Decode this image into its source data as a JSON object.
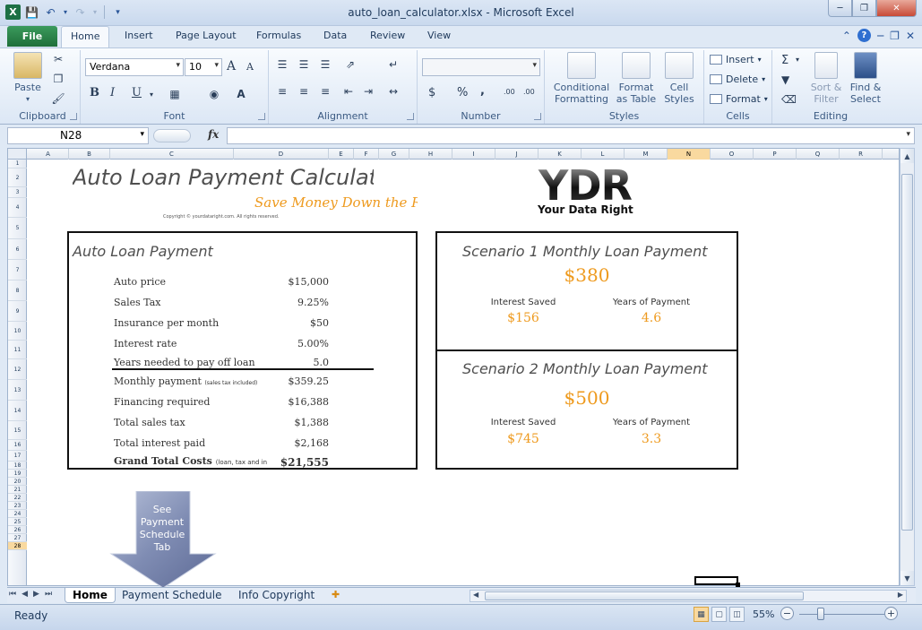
{
  "window": {
    "title": "auto_loan_calculator.xlsx - Microsoft Excel",
    "app_icon_letter": "X"
  },
  "ribbon_tabs": [
    "File",
    "Home",
    "Insert",
    "Page Layout",
    "Formulas",
    "Data",
    "Review",
    "View"
  ],
  "active_tab": "Home",
  "clipboard": {
    "paste": "Paste",
    "label": "Clipboard"
  },
  "font": {
    "name": "Verdana",
    "size": "10",
    "label": "Font",
    "bold": "B",
    "italic": "I",
    "underline": "U",
    "grow": "A",
    "shrink": "A"
  },
  "alignment": {
    "label": "Alignment"
  },
  "number": {
    "format": "",
    "label": "Number",
    "currency": "$",
    "percent": "%",
    "comma": ",",
    "inc_decimal": ".00",
    "dec_decimal": ".00"
  },
  "styles": {
    "label": "Styles",
    "conditional_line1": "Conditional",
    "conditional_line2": "Formatting",
    "format_table_line1": "Format",
    "format_table_line2": "as Table",
    "cell_styles_line1": "Cell",
    "cell_styles_line2": "Styles"
  },
  "cells": {
    "label": "Cells",
    "insert": "Insert",
    "delete": "Delete",
    "format": "Format"
  },
  "editing": {
    "label": "Editing",
    "sum": "Σ",
    "sort_line1": "Sort &",
    "sort_line2": "Filter",
    "find_line1": "Find &",
    "find_line2": "Select"
  },
  "formula_bar": {
    "name_box": "N28",
    "fx": "fx",
    "formula": ""
  },
  "columns": [
    "A",
    "B",
    "C",
    "D",
    "E",
    "F",
    "G",
    "H",
    "I",
    "J",
    "K",
    "L",
    "M",
    "N",
    "O",
    "P",
    "Q",
    "R"
  ],
  "selected_column": "N",
  "rows": [
    "1",
    "2",
    "3",
    "4",
    "5",
    "6",
    "7",
    "8",
    "9",
    "10",
    "11",
    "12",
    "13",
    "14",
    "15",
    "16",
    "17",
    "18",
    "19",
    "20",
    "21",
    "22",
    "23",
    "24",
    "25",
    "26",
    "27",
    "28"
  ],
  "selected_row": "28",
  "sheet": {
    "title": "Auto Loan Payment Calculator",
    "subtitle": "Save Money Down the Road",
    "copyright": "Copyright © yourdataright.com. All rights reserved.",
    "logo_letters": "YDR",
    "logo_tagline": "Your Data Right"
  },
  "loan_box": {
    "title": "Auto Loan Payment",
    "rows": [
      {
        "label": "Auto price",
        "value": "$15,000"
      },
      {
        "label": "Sales Tax",
        "value": "9.25%"
      },
      {
        "label": "Insurance per month",
        "value": "$50"
      },
      {
        "label": "Interest rate",
        "value": "5.00%"
      },
      {
        "label": "Years needed to pay off loan",
        "value": "5.0"
      },
      {
        "label": "Monthly payment",
        "note": "(sales tax included)",
        "value": "$359.25"
      },
      {
        "label": "Financing required",
        "value": "$16,388"
      },
      {
        "label": "Total sales tax",
        "value": "$1,388"
      },
      {
        "label": "Total interest paid",
        "value": "$2,168"
      },
      {
        "label": "Grand Total Costs",
        "note": "(loan, tax and in",
        "value": "$21,555"
      }
    ]
  },
  "scenario1": {
    "title": "Scenario 1 Monthly Loan Payment",
    "amount": "$380",
    "interest_label": "Interest Saved",
    "interest_value": "$156",
    "years_label": "Years of Payment",
    "years_value": "4.6"
  },
  "scenario2": {
    "title": "Scenario 2 Monthly Loan Payment",
    "amount": "$500",
    "interest_label": "Interest Saved",
    "interest_value": "$745",
    "years_label": "Years of Payment",
    "years_value": "3.3"
  },
  "arrow_button": {
    "line1": "See",
    "line2": "Payment",
    "line3": "Schedule",
    "line4": "Tab"
  },
  "sheet_tabs": [
    "Home",
    "Payment Schedule",
    "Info Copyright"
  ],
  "active_sheet": "Home",
  "status": {
    "ready": "Ready",
    "zoom": "55%",
    "zoom_level": 0.55
  },
  "colors": {
    "accent_orange": "#ee9a1e",
    "excel_green": "#1f6f3a",
    "box_border": "#111111"
  }
}
